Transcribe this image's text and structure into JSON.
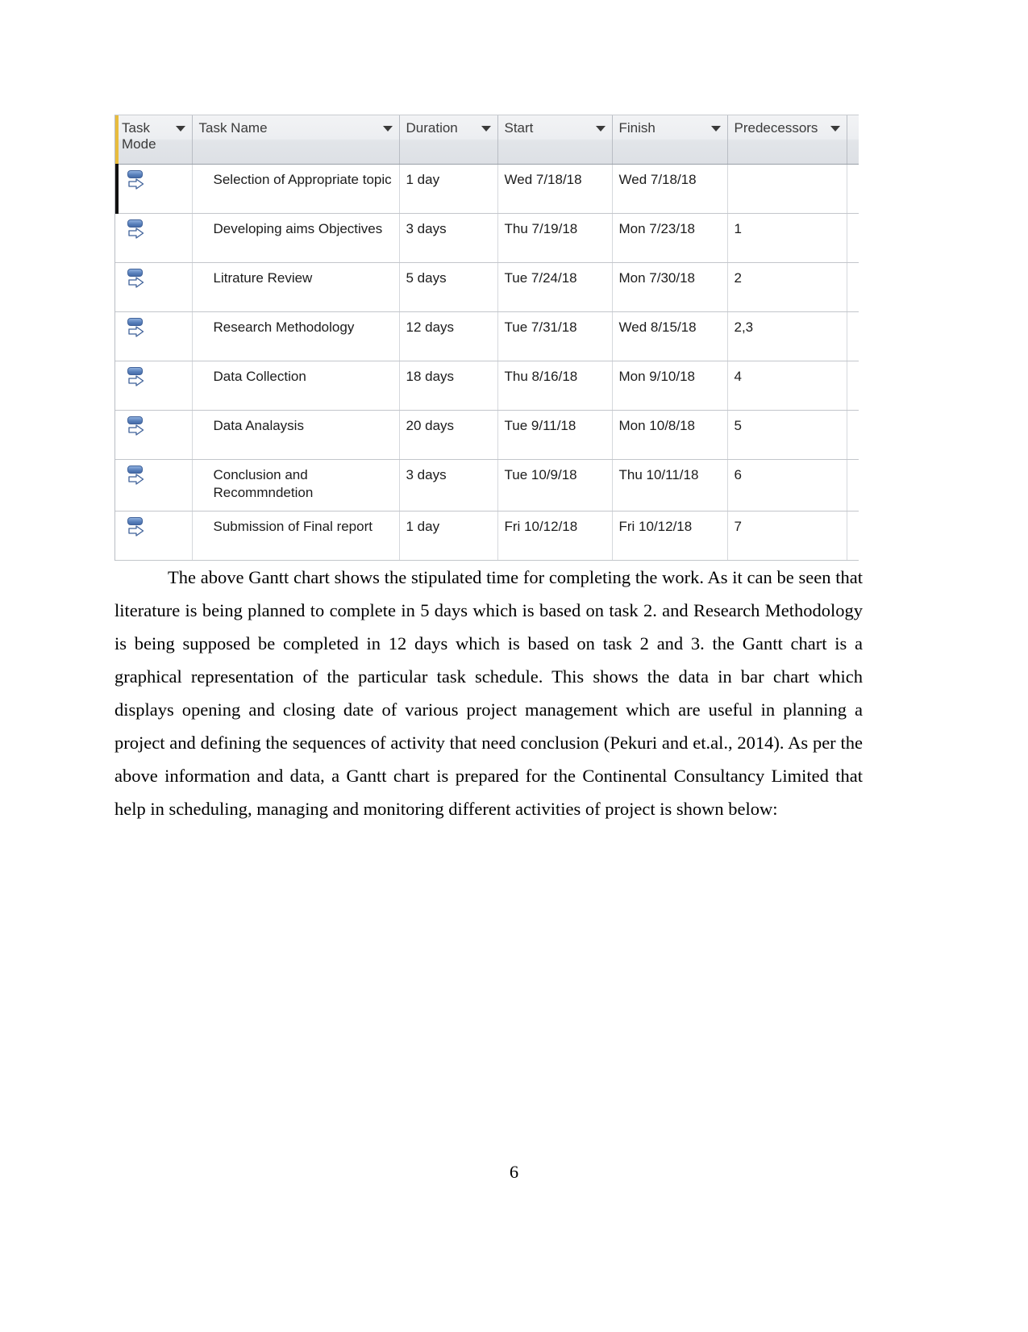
{
  "document": {
    "page_number": "6"
  },
  "gantt_table": {
    "columns": [
      {
        "label": "Task Mode",
        "icon": "chevron-down-icon"
      },
      {
        "label": "Task Name",
        "icon": "chevron-down-icon"
      },
      {
        "label": "Duration",
        "icon": "chevron-down-icon"
      },
      {
        "label": "Start",
        "icon": "chevron-down-icon"
      },
      {
        "label": "Finish",
        "icon": "chevron-down-icon"
      },
      {
        "label": "Predecessors",
        "icon": "chevron-down-icon"
      }
    ],
    "rows": [
      {
        "task_mode_icon": "manually-scheduled-icon",
        "name": "Selection of Appropriate topic",
        "duration": "1 day",
        "start": "Wed 7/18/18",
        "finish": "Wed 7/18/18",
        "predecessors": ""
      },
      {
        "task_mode_icon": "manually-scheduled-icon",
        "name": "Developing aims Objectives",
        "duration": "3 days",
        "start": "Thu 7/19/18",
        "finish": "Mon 7/23/18",
        "predecessors": "1"
      },
      {
        "task_mode_icon": "manually-scheduled-icon",
        "name": "Litrature Review",
        "duration": "5 days",
        "start": "Tue 7/24/18",
        "finish": "Mon 7/30/18",
        "predecessors": "2"
      },
      {
        "task_mode_icon": "manually-scheduled-icon",
        "name": "Research Methodology",
        "duration": "12 days",
        "start": "Tue 7/31/18",
        "finish": "Wed 8/15/18",
        "predecessors": "2,3"
      },
      {
        "task_mode_icon": "manually-scheduled-icon",
        "name": "Data Collection",
        "duration": "18 days",
        "start": "Thu 8/16/18",
        "finish": "Mon 9/10/18",
        "predecessors": "4"
      },
      {
        "task_mode_icon": "manually-scheduled-icon",
        "name": "Data Analaysis",
        "duration": "20 days",
        "start": "Tue 9/11/18",
        "finish": "Mon 10/8/18",
        "predecessors": "5"
      },
      {
        "task_mode_icon": "manually-scheduled-icon",
        "name": "Conclusion and Recommndetion",
        "duration": "3 days",
        "start": "Tue 10/9/18",
        "finish": "Thu 10/11/18",
        "predecessors": "6"
      },
      {
        "task_mode_icon": "manually-scheduled-icon",
        "name": "Submission of Final report",
        "duration": "1 day",
        "start": "Fri 10/12/18",
        "finish": "Fri 10/12/18",
        "predecessors": "7"
      }
    ]
  },
  "paragraph": {
    "text": "The above Gantt chart shows the stipulated time for completing the work. As it can be seen that literature is being planned to complete in 5 days which is based on task 2. and Research Methodology is being supposed be completed in 12 days which is based on task 2 and 3. the Gantt chart is a graphical representation of the particular task schedule. This shows the data in bar chart which displays opening and closing date of various project management which are useful in planning a project and defining the sequences of activity that need conclusion (Pekuri and et.al., 2014). As per the above information and data, a Gantt chart is prepared for the Continental Consultancy Limited that help in scheduling, managing and monitoring different activities of project is shown below:"
  }
}
